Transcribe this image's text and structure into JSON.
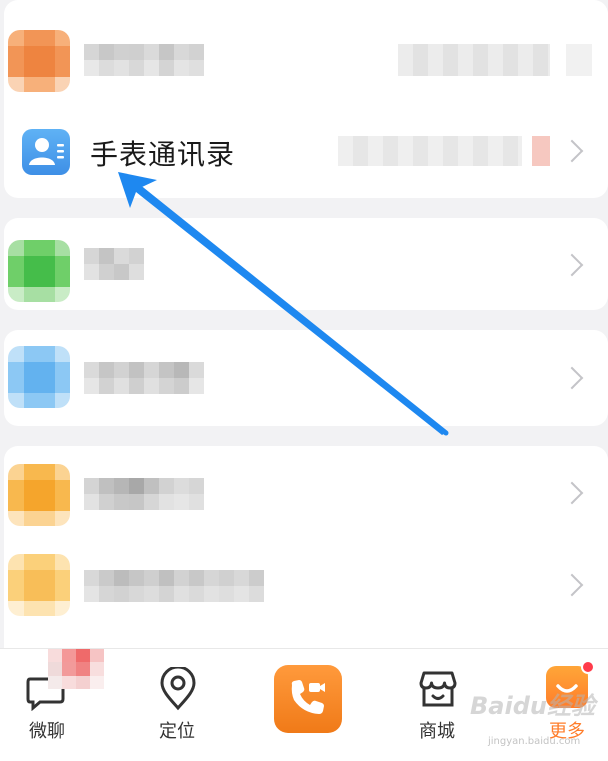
{
  "contacts_row": {
    "title": "手表通讯录"
  },
  "tabbar": {
    "tabs": [
      {
        "label": "微聊",
        "icon": "chat-icon"
      },
      {
        "label": "定位",
        "icon": "location-pin-icon"
      },
      {
        "label": "",
        "icon": "video-call-icon"
      },
      {
        "label": "商城",
        "icon": "store-icon"
      },
      {
        "label": "更多",
        "icon": "more-smile-icon"
      }
    ]
  },
  "watermark": {
    "text": "Baidu经验",
    "sub": "jingyan.baidu.com"
  },
  "colors": {
    "accent_orange": "#f07a18",
    "arrow_blue": "#1e88f0",
    "contacts_blue": "#3e8fe6",
    "badge_red": "#ff3b4a"
  }
}
